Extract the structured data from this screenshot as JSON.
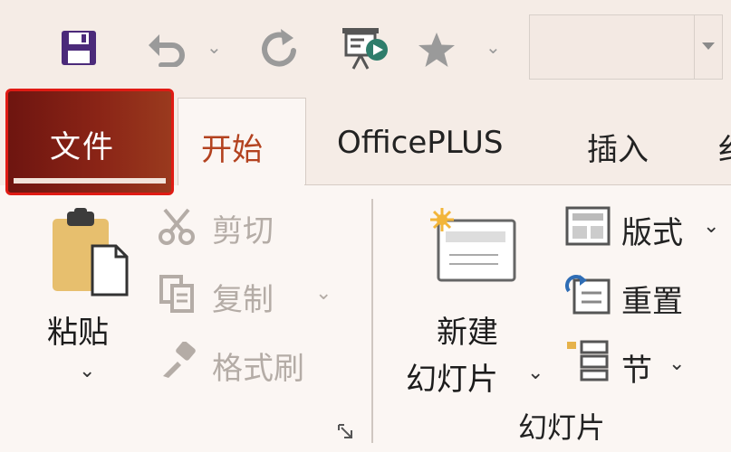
{
  "quick_access": {
    "icons": [
      "save-icon",
      "undo-icon",
      "redo-icon",
      "start-slideshow-icon",
      "star-icon"
    ],
    "title_box": ""
  },
  "tabs": [
    {
      "id": "file",
      "label": "文件",
      "selected": false,
      "highlighted": true
    },
    {
      "id": "home",
      "label": "开始",
      "selected": true
    },
    {
      "id": "officeplus",
      "label": "OfficePLUS",
      "selected": false
    },
    {
      "id": "insert",
      "label": "插入",
      "selected": false
    },
    {
      "id": "partial",
      "label": "纟",
      "selected": false
    }
  ],
  "clipboard": {
    "paste_label_1": "粘贴",
    "cut_label": "剪切",
    "copy_label": "复制",
    "format_painter_label": "格式刷",
    "disabled": [
      "cut",
      "copy",
      "format_painter"
    ]
  },
  "slides": {
    "new_slide_line1": "新建",
    "new_slide_line2": "幻灯片",
    "layout_label": "版式",
    "reset_label": "重置",
    "section_label": "节",
    "group_label": "幻灯片"
  },
  "colors": {
    "file_tab": "#8a2416",
    "file_border": "#e01b14",
    "active_tab_text": "#b3421f",
    "save_icon": "#4b2a7a",
    "disabled_text": "#b4aca6"
  }
}
